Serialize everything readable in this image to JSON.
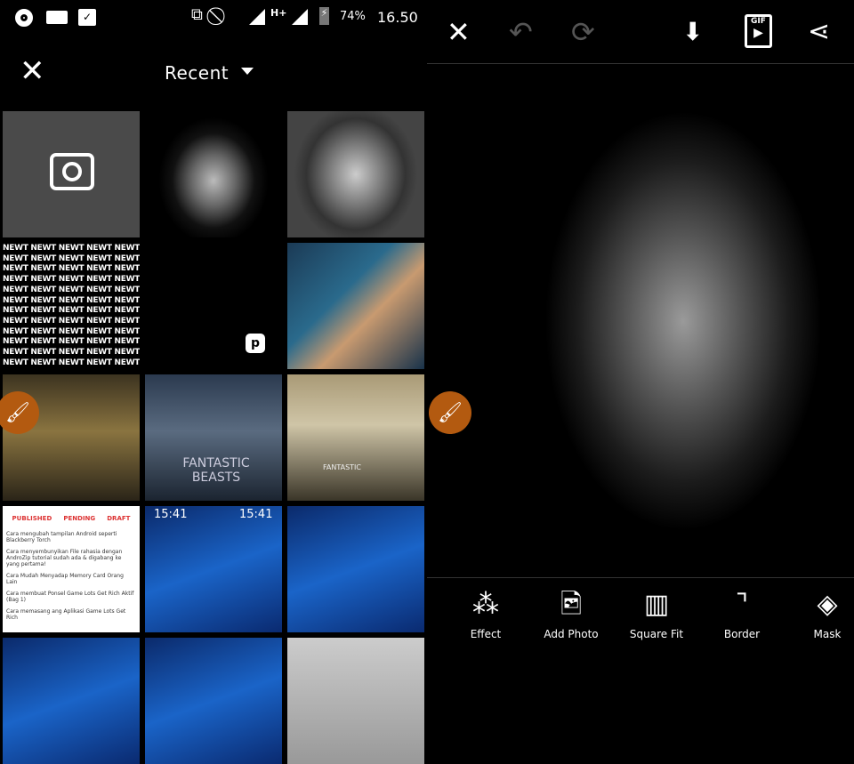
{
  "status_bar": {
    "battery": "74%",
    "time": "16.50",
    "network": "H+"
  },
  "gallery": {
    "close_icon": "close-icon",
    "album": "Recent",
    "newt_text": "NEWT NEWT NEWT NEWT NEWT NEWT",
    "fb_text": "FANTASTIC BEASTS",
    "fb_text2": "FANTASTIC",
    "clock": "15:41",
    "blog_tabs": [
      "PUBLISHED",
      "PENDING",
      "DRAFT"
    ],
    "blog_items": [
      "Cara mengubah tampilan Android seperti Blackberry Torch",
      "Cara menyembunyikan File rahasia dengan AndroZip tutorial sudah ada & digabang ke yang pertama!",
      "Cara Mudah Menyadap Memory Card Orang Lain",
      "Cara membuat Ponsel Game Lots Get Rich Aktif (Bag 1)",
      "Cara memasang ang Aplikasi Game Lots Get Rich"
    ]
  },
  "editor": {
    "tools": [
      {
        "label": "Effect",
        "icon": "magic-wand-icon"
      },
      {
        "label": "Add Photo",
        "icon": "add-photo-icon"
      },
      {
        "label": "Square Fit",
        "icon": "square-fit-icon"
      },
      {
        "label": "Border",
        "icon": "border-icon"
      },
      {
        "label": "Mask",
        "icon": "mask-icon"
      }
    ],
    "gif_label": "GIF",
    "accent": "#b35a10"
  }
}
